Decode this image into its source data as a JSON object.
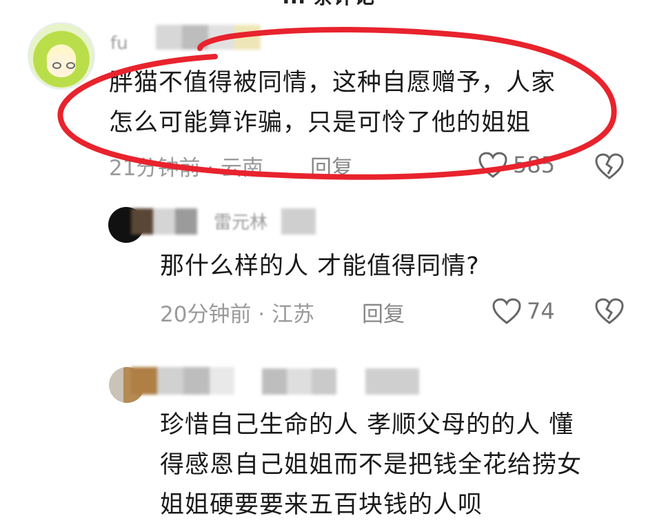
{
  "header": {
    "title": "... 条评论"
  },
  "comments": [
    {
      "username_fragment": "fu",
      "text_lines": [
        "胖猫不值得被同情，这种自愿赠予，人家",
        "怎么可能算诈骗，只是可怜了他的姐姐"
      ],
      "meta": "21分钟前 · 云南",
      "reply": "回复",
      "likes": "585"
    },
    {
      "username_fragment": "雷元林",
      "text_lines": [
        "那什么样的人  才能值得同情?"
      ],
      "meta": "20分钟前 · 江苏",
      "reply": "回复",
      "likes": "74"
    },
    {
      "text_lines": [
        "珍惜自己生命的人 孝顺父母的的人 懂",
        "得感恩自己姐姐而不是把钱全花给捞女",
        "姐姐硬要要来五百块钱的人呗"
      ]
    }
  ],
  "colors": {
    "highlight": "#e8232d",
    "meta_gray": "#9a9a9a"
  }
}
